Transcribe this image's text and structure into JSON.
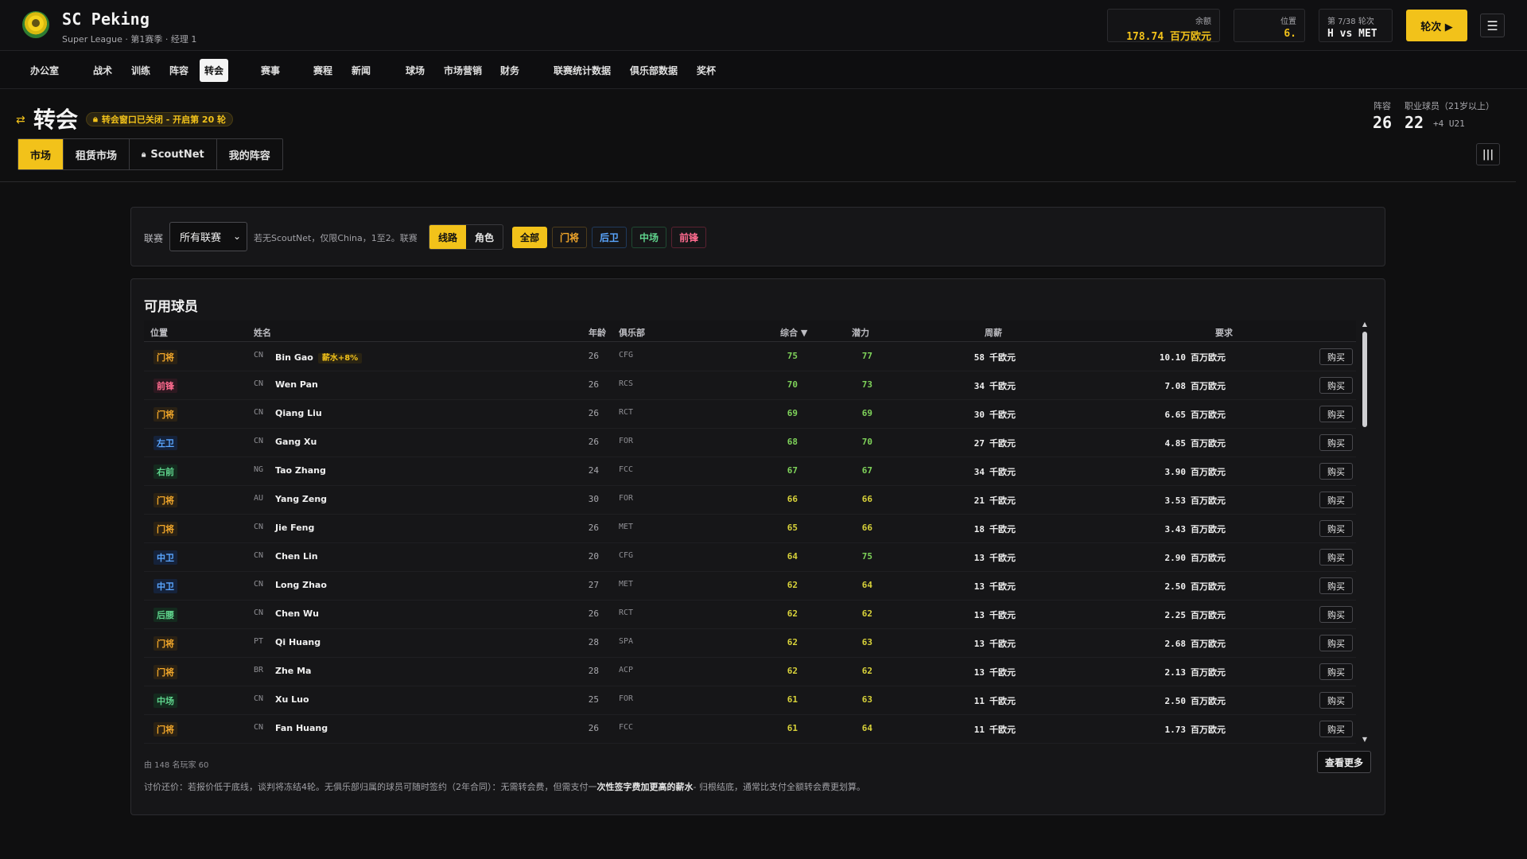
{
  "club": {
    "name": "SC Peking",
    "subtitle": "Super League · 第1赛季 · 经理 1"
  },
  "stats": {
    "balance": {
      "label": "余额",
      "value": "178.74 百万欧元"
    },
    "position": {
      "label": "位置",
      "value": "6."
    },
    "round": {
      "label": "第 7/38 轮次",
      "value": "H vs MET"
    }
  },
  "round_button": "轮次 ▶",
  "nav": [
    "办公室",
    "战术",
    "训练",
    "阵容",
    "转会",
    "赛事",
    "赛程",
    "新闻",
    "球场",
    "市场营销",
    "财务",
    "联赛统计数据",
    "俱乐部数据",
    "奖杯"
  ],
  "nav_active": "转会",
  "page": {
    "title": "转会",
    "window_badge": "转会窗口已关闭 - 开启第 20 轮",
    "tabs": [
      "市场",
      "租赁市场",
      "ScoutNet",
      "我的阵容"
    ],
    "squad_label": "阵容",
    "squad_value": "26",
    "pro_label": "职业球员（21岁以上）",
    "pro_value": "22",
    "u21": "+4 U21"
  },
  "filters": {
    "league_label": "联赛",
    "league_value": "所有联赛",
    "hint": "若无ScoutNet，仅限China，1至2。联赛",
    "mode": [
      "线路",
      "角色"
    ],
    "positions": [
      "全部",
      "门将",
      "后卫",
      "中场",
      "前锋"
    ]
  },
  "table": {
    "title": "可用球员",
    "headers": {
      "pos": "位置",
      "name": "姓名",
      "age": "年龄",
      "club": "俱乐部",
      "ovr": "综合 ▼",
      "pot": "潜力",
      "wage": "周薪",
      "fee": "要求"
    },
    "wage_unit": "千欧元",
    "fee_unit": "百万欧元",
    "buy_label": "购买",
    "rows": [
      {
        "pos": "门将",
        "pcls": "gk",
        "nat": "CN",
        "name": "Bin Gao",
        "tag": "薪水+8%",
        "age": "26",
        "club": "CFG",
        "ovr": "75",
        "pot": "77",
        "wage": "58",
        "fee": "10.10"
      },
      {
        "pos": "前锋",
        "pcls": "fw",
        "nat": "CN",
        "name": "Wen Pan",
        "tag": "",
        "age": "26",
        "club": "RCS",
        "ovr": "70",
        "pot": "73",
        "wage": "34",
        "fee": "7.08"
      },
      {
        "pos": "门将",
        "pcls": "gk",
        "nat": "CN",
        "name": "Qiang Liu",
        "tag": "",
        "age": "26",
        "club": "RCT",
        "ovr": "69",
        "pot": "69",
        "wage": "30",
        "fee": "6.65"
      },
      {
        "pos": "左卫",
        "pcls": "df",
        "nat": "CN",
        "name": "Gang Xu",
        "tag": "",
        "age": "26",
        "club": "FOR",
        "ovr": "68",
        "pot": "70",
        "wage": "27",
        "fee": "4.85"
      },
      {
        "pos": "右前",
        "pcls": "mf",
        "nat": "NG",
        "name": "Tao Zhang",
        "tag": "",
        "age": "24",
        "club": "FCC",
        "ovr": "67",
        "pot": "67",
        "wage": "34",
        "fee": "3.90"
      },
      {
        "pos": "门将",
        "pcls": "gk",
        "nat": "AU",
        "name": "Yang Zeng",
        "tag": "",
        "age": "30",
        "club": "FOR",
        "ovr": "66",
        "pot": "66",
        "wage": "21",
        "fee": "3.53"
      },
      {
        "pos": "门将",
        "pcls": "gk",
        "nat": "CN",
        "name": "Jie Feng",
        "tag": "",
        "age": "26",
        "club": "MET",
        "ovr": "65",
        "pot": "66",
        "wage": "18",
        "fee": "3.43"
      },
      {
        "pos": "中卫",
        "pcls": "df",
        "nat": "CN",
        "name": "Chen Lin",
        "tag": "",
        "age": "20",
        "club": "CFG",
        "ovr": "64",
        "pot": "75",
        "wage": "13",
        "fee": "2.90"
      },
      {
        "pos": "中卫",
        "pcls": "df",
        "nat": "CN",
        "name": "Long Zhao",
        "tag": "",
        "age": "27",
        "club": "MET",
        "ovr": "62",
        "pot": "64",
        "wage": "13",
        "fee": "2.50"
      },
      {
        "pos": "后腰",
        "pcls": "mf",
        "nat": "CN",
        "name": "Chen Wu",
        "tag": "",
        "age": "26",
        "club": "RCT",
        "ovr": "62",
        "pot": "62",
        "wage": "13",
        "fee": "2.25"
      },
      {
        "pos": "门将",
        "pcls": "gk",
        "nat": "PT",
        "name": "Qi Huang",
        "tag": "",
        "age": "28",
        "club": "SPA",
        "ovr": "62",
        "pot": "63",
        "wage": "13",
        "fee": "2.68"
      },
      {
        "pos": "门将",
        "pcls": "gk",
        "nat": "BR",
        "name": "Zhe Ma",
        "tag": "",
        "age": "28",
        "club": "ACP",
        "ovr": "62",
        "pot": "62",
        "wage": "13",
        "fee": "2.13"
      },
      {
        "pos": "中场",
        "pcls": "mf",
        "nat": "CN",
        "name": "Xu Luo",
        "tag": "",
        "age": "25",
        "club": "FOR",
        "ovr": "61",
        "pot": "63",
        "wage": "11",
        "fee": "2.50"
      },
      {
        "pos": "门将",
        "pcls": "gk",
        "nat": "CN",
        "name": "Fan Huang",
        "tag": "",
        "age": "26",
        "club": "FCC",
        "ovr": "61",
        "pot": "64",
        "wage": "11",
        "fee": "1.73"
      }
    ],
    "count_text": "由 148 名玩家 60",
    "more_label": "查看更多",
    "note_prefix": "讨价还价：若报价低于底线，谈判将冻结4轮。无俱乐部归属的球员可随时签约（2年合同）：无需转会费，但需支付一",
    "note_bold": "次性签字费加更高的薪水",
    "note_suffix": "- 归根结底，通常比支付全额转会费更划算。"
  },
  "colors": {
    "accent": "#f2c21a",
    "ovr_high": "#7fd35a",
    "ovr_mid": "#d8d23a",
    "gk": "#f2a72a",
    "df": "#5aa6ff",
    "mf": "#5fd38c",
    "fw": "#ff6b8f"
  }
}
